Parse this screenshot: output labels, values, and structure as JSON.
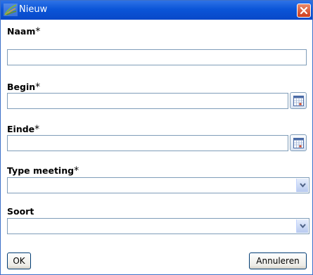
{
  "window": {
    "title": "Nieuw",
    "icons": {
      "app": "leaf-logo-icon",
      "close": "close-x-icon"
    },
    "colors": {
      "titlebar": "#0b55d8",
      "close": "#d84a2a",
      "border": "#7f9db9"
    }
  },
  "form": {
    "naam": {
      "label": "Naam",
      "required_mark": "*",
      "value": ""
    },
    "begin": {
      "label": "Begin",
      "required_mark": "*",
      "value": "",
      "button_icon": "calendar-icon"
    },
    "einde": {
      "label": "Einde",
      "required_mark": "*",
      "value": "",
      "button_icon": "calendar-icon"
    },
    "type_meeting": {
      "label": "Type meeting",
      "required_mark": "*",
      "selected": ""
    },
    "soort": {
      "label": "Soort",
      "selected": ""
    }
  },
  "buttons": {
    "ok": "OK",
    "cancel": "Annuleren"
  }
}
